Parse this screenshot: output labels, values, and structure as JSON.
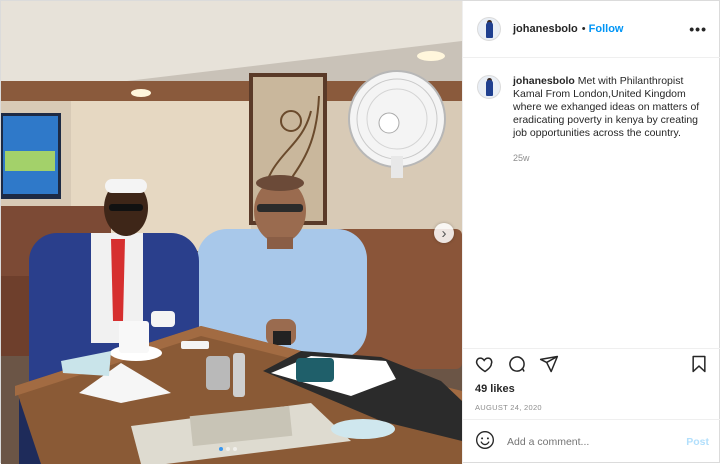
{
  "header": {
    "username": "johanesbolo",
    "separator": "•",
    "follow_label": "Follow",
    "more_label": "•••"
  },
  "caption": {
    "username": "johanesbolo",
    "text": "Met with Philanthropist Kamal From London,United Kingdom where we exhanged ideas on matters of eradicating poverty in kenya by creating job opportunities across the country.",
    "time": "25w"
  },
  "actions": {
    "likes": "49 likes",
    "date": "AUGUST 24, 2020"
  },
  "comment_box": {
    "placeholder": "Add a comment...",
    "post_label": "Post"
  },
  "photo": {
    "carousel": {
      "current": 1,
      "total": 3
    },
    "next_arrow": "›"
  },
  "colors": {
    "link_blue": "#0095f6",
    "post_disabled": "#b2dffc",
    "muted": "#8e8e8e"
  }
}
